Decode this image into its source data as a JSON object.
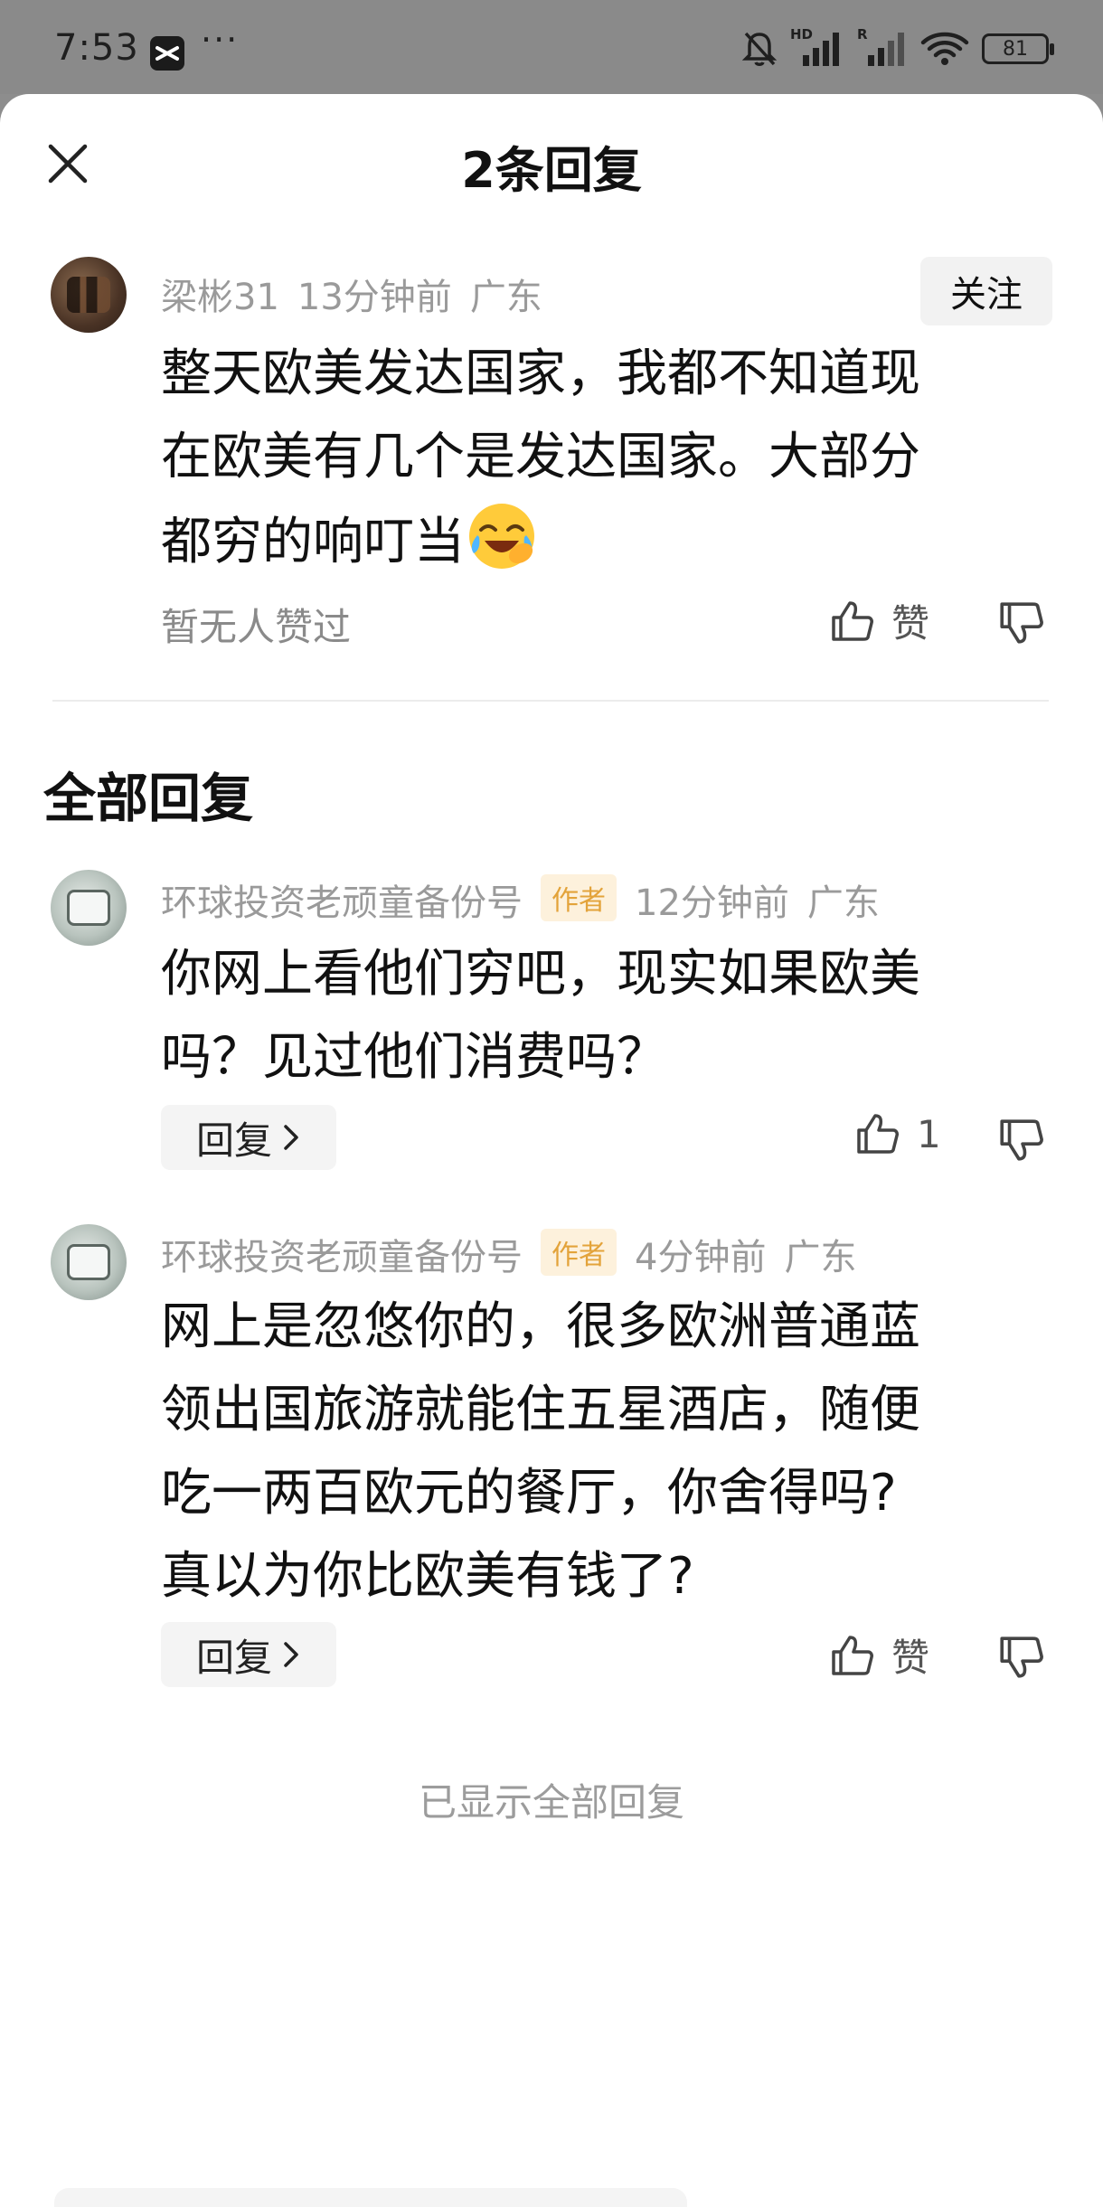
{
  "status_bar": {
    "time": "7:53",
    "dots": "···",
    "battery": "81",
    "signal_label_1": "HD",
    "signal_label_2": "R"
  },
  "sheet": {
    "title": "2条回复"
  },
  "main_comment": {
    "username": "梁彬31",
    "time": "13分钟前",
    "location": "广东",
    "follow_label": "关注",
    "text_line1": "整天欧美发达国家，我都不知道现",
    "text_line2": "在欧美有几个是发达国家。大部分",
    "text_line3": "都穷的响叮当",
    "emoji": "laughing-crying-emoji",
    "likes_status": "暂无人赞过",
    "like_label": "赞"
  },
  "section": {
    "title": "全部回复"
  },
  "replies": [
    {
      "username": "环球投资老顽童备份号",
      "tag": "作者",
      "time": "12分钟前",
      "location": "广东",
      "text_line1": "你网上看他们穷吧，现实如果欧美",
      "text_line2": "吗？见过他们消费吗？",
      "reply_label": "回复",
      "like_label": "1"
    },
    {
      "username": "环球投资老顽童备份号",
      "tag": "作者",
      "time": "4分钟前",
      "location": "广东",
      "text_line1": "网上是忽悠你的，很多欧洲普通蓝",
      "text_line2": "领出国旅游就能住五星酒店，随便",
      "text_line3": "吃一两百欧元的餐厅，你舍得吗?",
      "text_line4": "真以为你比欧美有钱了?",
      "reply_label": "回复",
      "like_label": "赞"
    }
  ],
  "footer": {
    "note": "已显示全部回复"
  }
}
